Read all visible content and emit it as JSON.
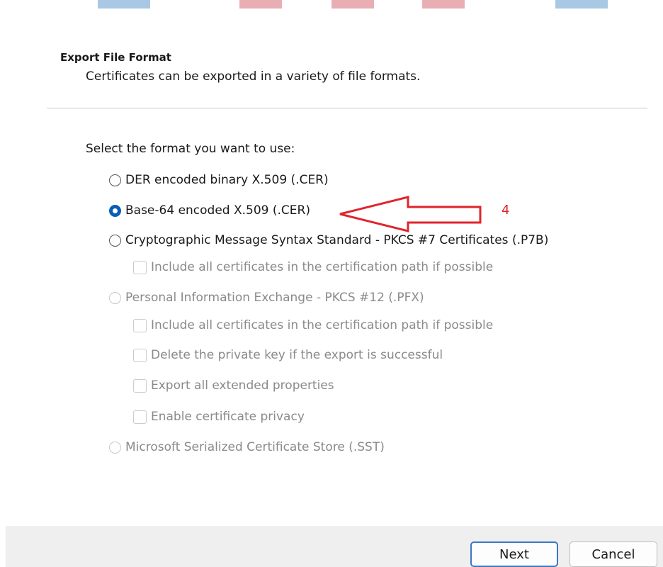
{
  "header": {
    "title": "Export File Format",
    "subtitle": "Certificates can be exported in a variety of file formats."
  },
  "prompt": "Select the format you want to use:",
  "options": [
    {
      "label": "DER encoded binary X.509 (.CER)",
      "selected": false,
      "enabled": true
    },
    {
      "label": "Base-64 encoded X.509 (.CER)",
      "selected": true,
      "enabled": true
    },
    {
      "label": "Cryptographic Message Syntax Standard - PKCS #7 Certificates (.P7B)",
      "selected": false,
      "enabled": true
    },
    {
      "label": "Personal Information Exchange - PKCS #12 (.PFX)",
      "selected": false,
      "enabled": false
    },
    {
      "label": "Microsoft Serialized Certificate Store (.SST)",
      "selected": false,
      "enabled": false
    }
  ],
  "p7b_options": [
    {
      "label": "Include all certificates in the certification path if possible",
      "checked": false,
      "enabled": false
    }
  ],
  "pfx_options": [
    {
      "label": "Include all certificates in the certification path if possible",
      "checked": false,
      "enabled": false
    },
    {
      "label": "Delete the private key if the export is successful",
      "checked": false,
      "enabled": false
    },
    {
      "label": "Export all extended properties",
      "checked": false,
      "enabled": false
    },
    {
      "label": "Enable certificate privacy",
      "checked": false,
      "enabled": false
    }
  ],
  "annotation": {
    "number": "4",
    "color": "#e0242c"
  },
  "footer": {
    "next_label": "Next",
    "cancel_label": "Cancel"
  },
  "colors": {
    "accent": "#0a5fb4",
    "disabled_text": "#8a8a8a"
  }
}
